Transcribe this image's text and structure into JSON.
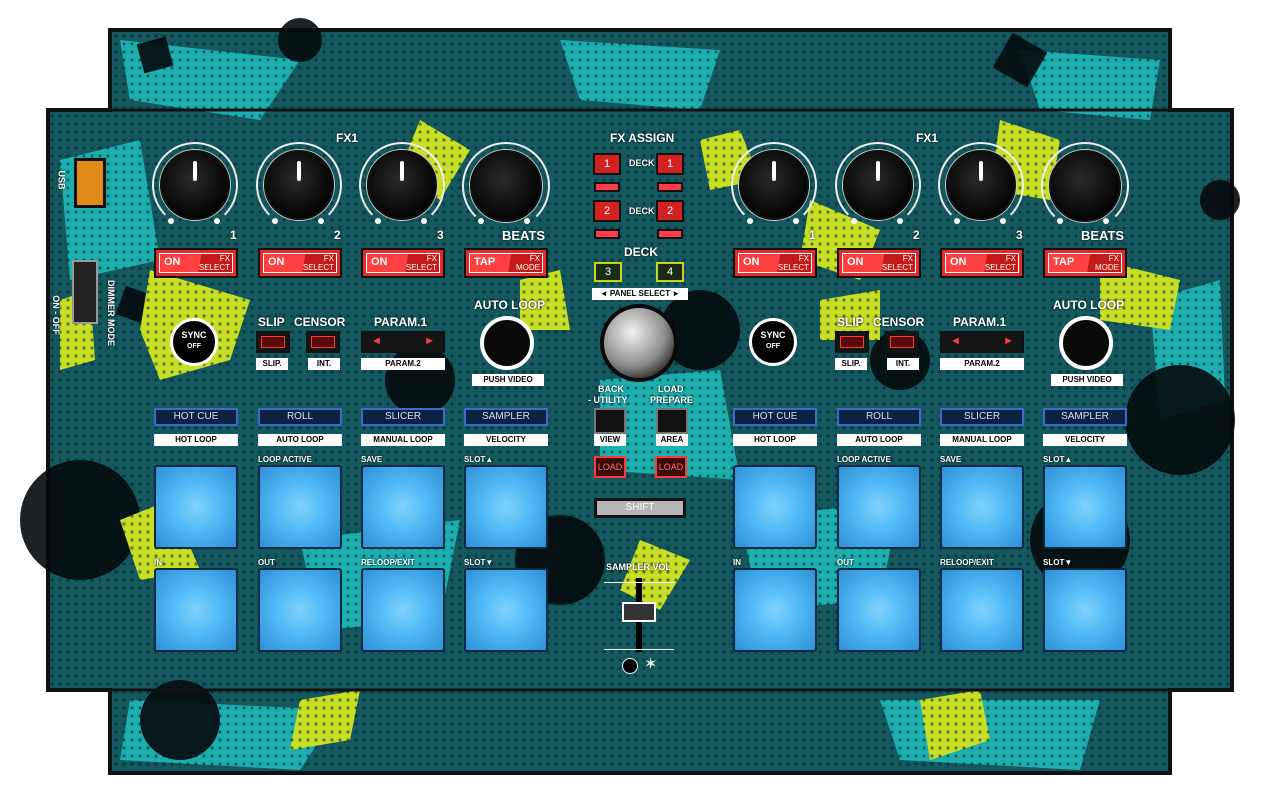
{
  "colors": {
    "background": "#14595f",
    "teal": "#1ab5b3",
    "lime": "#c8e024",
    "pad": "#4fb8f5",
    "red": "#e32a2a"
  },
  "left_side": {
    "usb": "USB",
    "dimmer": "DIMMER MODE",
    "onoff": "ON - OFF"
  },
  "fx_header": "FX1",
  "fx_assign": {
    "title": "FX ASSIGN",
    "deck": "DECK",
    "btn1": "1",
    "btn2": "2"
  },
  "deck_select": {
    "title": "DECK",
    "left": "3",
    "right": "4",
    "panel": "PANEL SELECT"
  },
  "knob_numbers": [
    "1",
    "2",
    "3"
  ],
  "beats": "BEATS",
  "fx_buttons": [
    {
      "main": "ON",
      "sub1": "FX",
      "sub2": "SELECT"
    },
    {
      "main": "ON",
      "sub1": "FX",
      "sub2": "SELECT"
    },
    {
      "main": "ON",
      "sub1": "FX",
      "sub2": "SELECT"
    },
    {
      "main": "TAP",
      "sub1": "FX",
      "sub2": "MODE"
    }
  ],
  "sync": {
    "top": "SYNC",
    "bottom": "OFF"
  },
  "slip": "SLIP",
  "censor": "CENSOR",
  "slip_sub": "SLIP.",
  "int_sub": "INT.",
  "param1": "PARAM.1",
  "param2": "PARAM.2",
  "auto_loop": "AUTO LOOP",
  "push_video": "PUSH VIDEO",
  "modes": [
    "HOT CUE",
    "ROLL",
    "SLICER",
    "SAMPLER"
  ],
  "mode_subs": [
    "HOT LOOP",
    "AUTO LOOP",
    "MANUAL LOOP",
    "VELOCITY"
  ],
  "pad_labels_top": [
    "",
    "LOOP ACTIVE",
    "SAVE",
    "SLOT▲"
  ],
  "pad_labels_bottom": [
    "IN",
    "OUT",
    "RELOOP/EXIT",
    "SLOT▼"
  ],
  "browse": {
    "back": "BACK",
    "utility": "- UTILITY",
    "load": "LOAD",
    "prepare": "PREPARE",
    "view": "VIEW",
    "area": "AREA",
    "load_btn": "LOAD"
  },
  "shift": "SHIFT",
  "sampler_vol": "SAMPLER VOL"
}
